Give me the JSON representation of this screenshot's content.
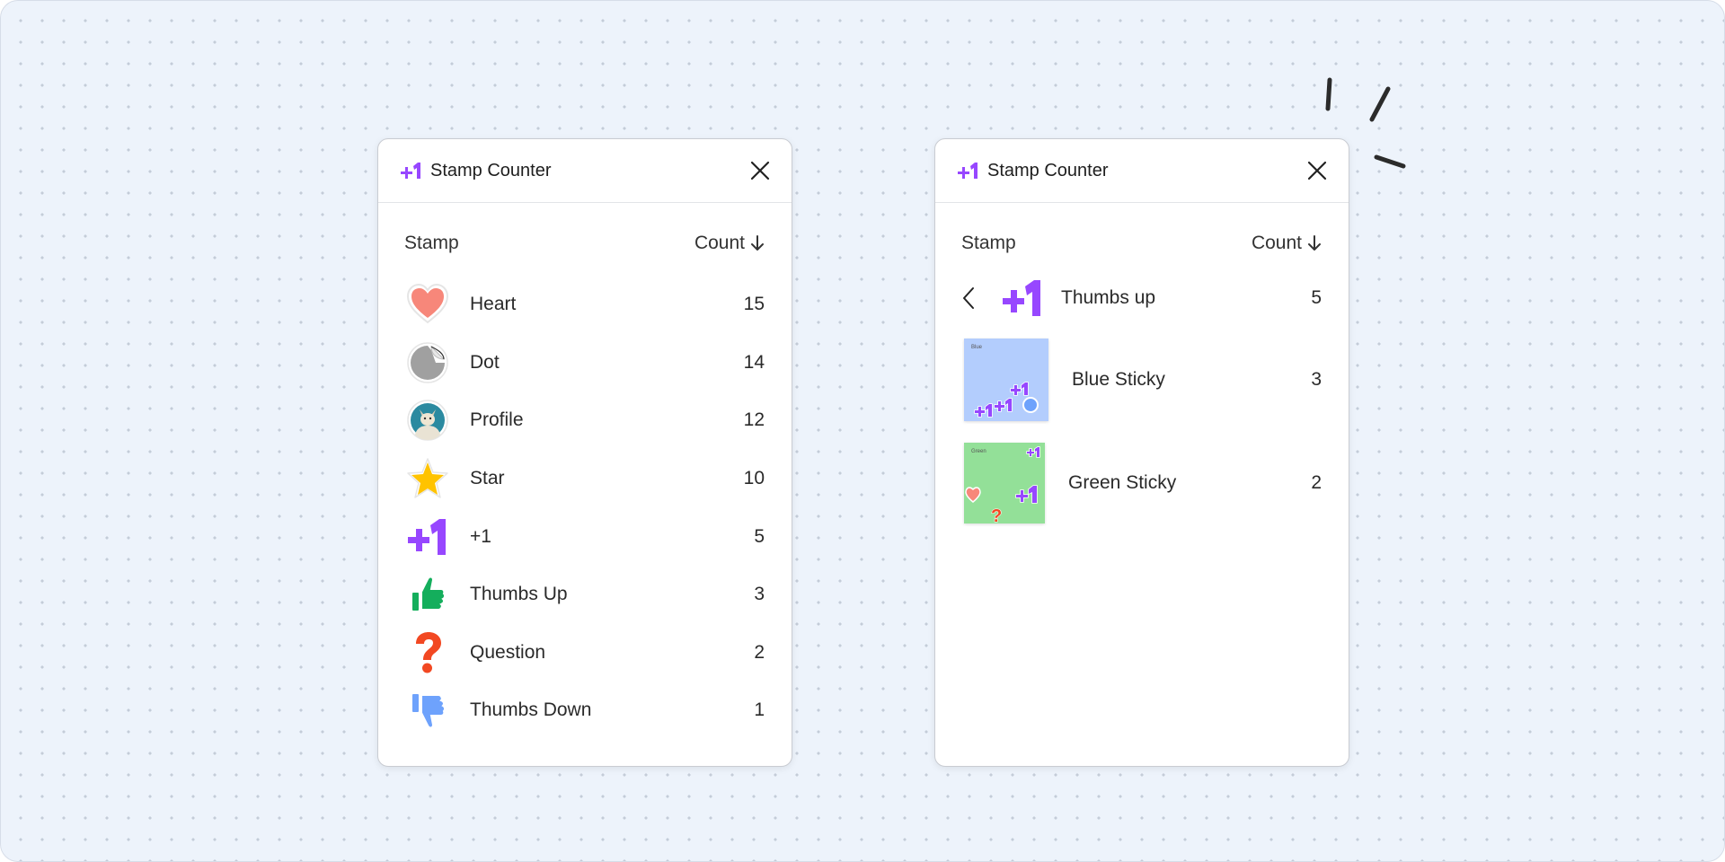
{
  "left_panel": {
    "title": "Stamp Counter",
    "col_stamp": "Stamp",
    "col_count": "Count",
    "rows": [
      {
        "label": "Heart",
        "count": "15",
        "icon": "heart-icon"
      },
      {
        "label": "Dot",
        "count": "14",
        "icon": "dot-icon"
      },
      {
        "label": "Profile",
        "count": "12",
        "icon": "profile-icon"
      },
      {
        "label": "Star",
        "count": "10",
        "icon": "star-icon"
      },
      {
        "label": "+1",
        "count": "5",
        "icon": "plus-one-icon"
      },
      {
        "label": "Thumbs Up",
        "count": "3",
        "icon": "thumbs-up-icon"
      },
      {
        "label": "Question",
        "count": "2",
        "icon": "question-icon"
      },
      {
        "label": "Thumbs Down",
        "count": "1",
        "icon": "thumbs-down-icon"
      }
    ]
  },
  "right_panel": {
    "title": "Stamp Counter",
    "col_stamp": "Stamp",
    "col_count": "Count",
    "selected": {
      "label": "Thumbs up",
      "count": "5",
      "icon": "plus-one-icon"
    },
    "stickies": [
      {
        "label": "Blue Sticky",
        "count": "3",
        "color": "#b3cdfd",
        "thumb_text": "Blue"
      },
      {
        "label": "Green Sticky",
        "count": "2",
        "color": "#93e098",
        "thumb_text": "Green"
      }
    ]
  },
  "colors": {
    "accent_purple": "#9747ff",
    "heart": "#f7877a",
    "star": "#ffc300",
    "thumbs_up": "#14ae5c",
    "question": "#f24822",
    "thumbs_down": "#6ea2fc"
  }
}
